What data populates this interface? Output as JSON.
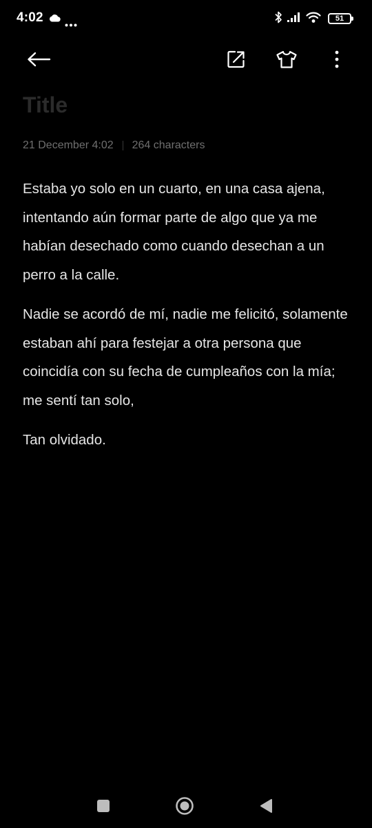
{
  "status_bar": {
    "time": "4:02",
    "battery_level": "51",
    "icons": [
      "cloud-icon",
      "more-notifications-icon",
      "bluetooth-icon",
      "signal-icon",
      "wifi-icon",
      "battery-icon"
    ]
  },
  "toolbar": {
    "icons": [
      "back-arrow-icon",
      "share-icon",
      "theme-shirt-icon",
      "more-vertical-icon"
    ]
  },
  "note": {
    "title_placeholder": "Title",
    "date": "21 December 4:02",
    "char_count": "264 characters",
    "paragraphs": [
      "Estaba yo solo en un cuarto, en una casa ajena, intentando aún formar parte de algo que ya me habían desechado como cuando desechan a un perro a la calle.",
      "Nadie se acordó de mí, nadie me felicitó, solamente estaban ahí para festejar a otra persona que coincidía con su fecha de cumpleaños con la mía; me sentí tan solo,",
      "Tan olvidado."
    ]
  },
  "nav_bar": {
    "icons": [
      "recents-square-icon",
      "home-circle-icon",
      "back-triangle-icon"
    ]
  },
  "colors": {
    "background": "#000000",
    "text": "#e6e6e6",
    "title_placeholder": "#2b2b2b",
    "meta": "#6f6f6f"
  }
}
